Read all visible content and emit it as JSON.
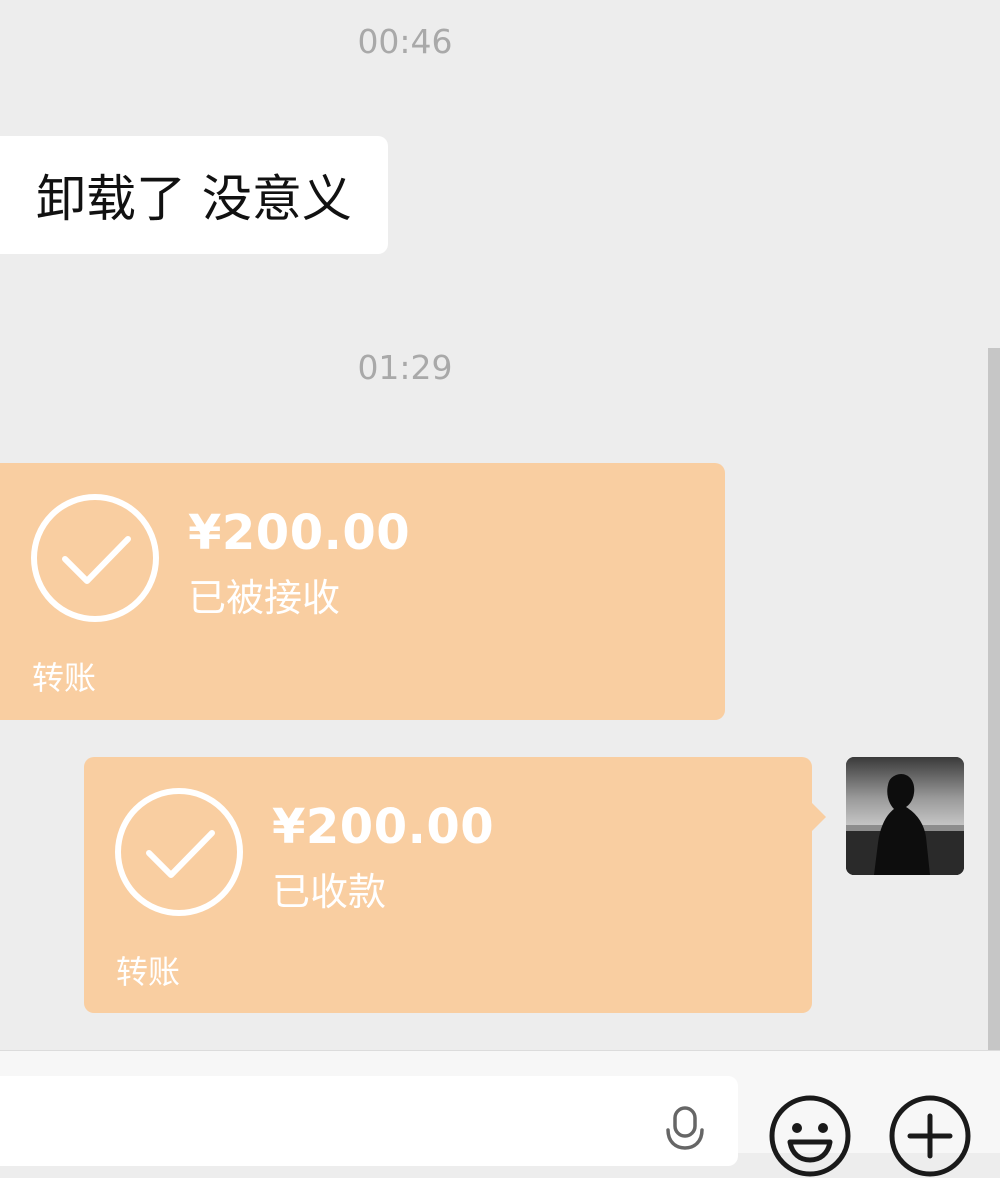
{
  "messages": {
    "timestamp_1": "00:46",
    "text_message": "卸载了 没意义",
    "timestamp_2": "01:29",
    "transfer_received": {
      "amount": "¥200.00",
      "status": "已被接收",
      "label": "转账"
    },
    "transfer_collected": {
      "amount": "¥200.00",
      "status": "已收款",
      "label": "转账"
    }
  },
  "colors": {
    "background": "#ededed",
    "transfer_bubble": "#f9cea1",
    "text_bubble": "#ffffff",
    "timestamp": "#a9a9a9"
  },
  "icons": [
    "check-circle-icon",
    "microphone-icon",
    "emoji-icon",
    "plus-icon"
  ]
}
